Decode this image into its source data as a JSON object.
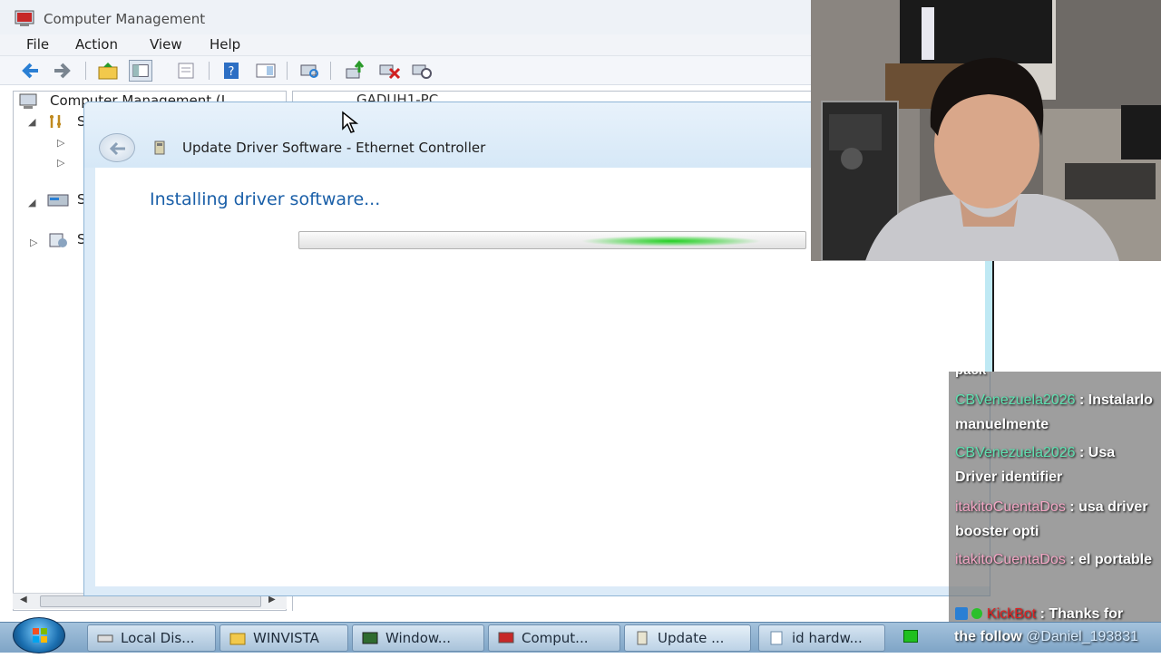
{
  "cm_window": {
    "title": "Computer Management",
    "menu": [
      "File",
      "Action",
      "View",
      "Help"
    ],
    "tree_root_partial": "Computer Management (L",
    "tree_letters": [
      "S",
      "S",
      "S"
    ],
    "content_partial": "GADUH1-PC"
  },
  "dialog": {
    "title": "Update Driver Software - Ethernet Controller",
    "status": "Installing driver software...",
    "progress_state": "indeterminate"
  },
  "chat": {
    "partial_top": "pack",
    "messages": [
      {
        "user": "CBVenezuela2026",
        "text": "Instalarlo manuelmente",
        "color": "#5fe0b0"
      },
      {
        "user": "CBVenezuela2026",
        "text": "Usa Driver identifier",
        "color": "#5fe0b0"
      },
      {
        "user": "itakitoCuentaDos",
        "text": "usa driver booster opti",
        "color": "#f2a6c4"
      },
      {
        "user": "itakitoCuentaDos",
        "text": "el portable",
        "color": "#f2a6c4"
      },
      {
        "user": "KickBot",
        "text": "Thanks for",
        "color": "#e02020"
      }
    ],
    "separator": " : "
  },
  "taskbar": {
    "buttons": [
      "Local Dis...",
      "WINVISTA",
      "Window...",
      "Comput...",
      "Update ...",
      "id hardw..."
    ],
    "ticker_text": "the follow",
    "ticker_user": "@Daniel_193831"
  },
  "colors": {
    "accent_text": "#1a5fa8",
    "progress_glow": "#22d022",
    "taskbar": "#8fb0d0"
  }
}
